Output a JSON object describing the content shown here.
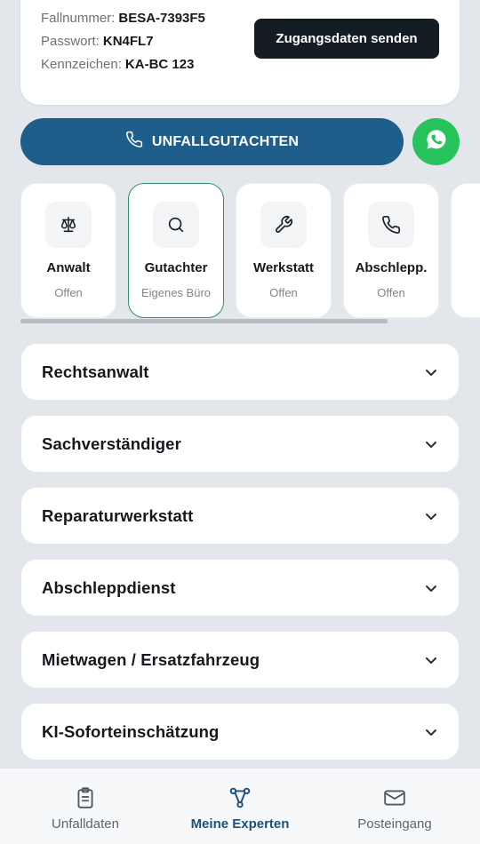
{
  "credentials": {
    "rows": [
      {
        "label": "Fallnummer:",
        "value": "BESA-7393F5"
      },
      {
        "label": "Passwort:",
        "value": "KN4FL7"
      },
      {
        "label": "Kennzeichen:",
        "value": "KA-BC 123"
      }
    ],
    "send_button": "Zugangsdaten senden"
  },
  "report_button": {
    "label": "UNFALLGUTACHTEN",
    "icon": "phone-icon",
    "color": "#1f5d8a"
  },
  "whatsapp_button": {
    "icon": "whatsapp-icon",
    "color": "#25c35a"
  },
  "experts": [
    {
      "title": "Anwalt",
      "status": "Offen",
      "icon": "scale-icon",
      "active": false
    },
    {
      "title": "Gutachter",
      "status": "Eigenes Büro",
      "icon": "search-icon",
      "active": true
    },
    {
      "title": "Werkstatt",
      "status": "Offen",
      "icon": "wrench-icon",
      "active": false
    },
    {
      "title": "Abschlepp.",
      "status": "Offen",
      "icon": "phone-icon",
      "active": false
    }
  ],
  "sections": [
    {
      "title": "Rechtsanwalt"
    },
    {
      "title": "Sachverständiger"
    },
    {
      "title": "Reparaturwerkstatt"
    },
    {
      "title": "Abschleppdienst"
    },
    {
      "title": "Mietwagen / Ersatzfahrzeug"
    },
    {
      "title": "KI-Soforteinschätzung"
    }
  ],
  "nav": {
    "items": [
      {
        "label": "Unfalldaten",
        "icon": "clipboard-icon",
        "active": false
      },
      {
        "label": "Meine Experten",
        "icon": "network-icon",
        "active": true
      },
      {
        "label": "Posteingang",
        "icon": "mail-icon",
        "active": false
      }
    ]
  },
  "colors": {
    "accent": "#1f5d8a",
    "active_border": "#2f8f72",
    "background": "#e3e6eb"
  }
}
